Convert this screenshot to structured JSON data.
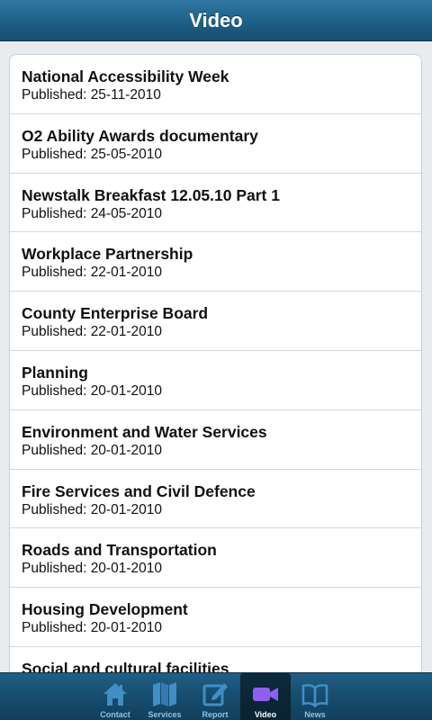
{
  "header": {
    "title": "Video"
  },
  "videos": [
    {
      "title": "National Accessibility Week",
      "published": "Published: 25-11-2010"
    },
    {
      "title": "O2 Ability Awards documentary",
      "published": "Published: 25-05-2010"
    },
    {
      "title": "Newstalk Breakfast 12.05.10 Part 1",
      "published": "Published: 24-05-2010"
    },
    {
      "title": "Workplace Partnership",
      "published": "Published: 22-01-2010"
    },
    {
      "title": "County Enterprise Board",
      "published": "Published: 22-01-2010"
    },
    {
      "title": "Planning",
      "published": "Published: 20-01-2010"
    },
    {
      "title": "Environment and Water Services",
      "published": "Published: 20-01-2010"
    },
    {
      "title": "Fire Services and Civil Defence",
      "published": "Published: 20-01-2010"
    },
    {
      "title": "Roads and Transportation",
      "published": "Published: 20-01-2010"
    },
    {
      "title": "Housing Development",
      "published": "Published: 20-01-2010"
    },
    {
      "title": "Social and cultural facilities",
      "published": ""
    }
  ],
  "tabs": [
    {
      "label": "Contact",
      "icon": "house-icon"
    },
    {
      "label": "Services",
      "icon": "map-icon"
    },
    {
      "label": "Report",
      "icon": "pencil-icon"
    },
    {
      "label": "Video",
      "icon": "video-camera-icon"
    },
    {
      "label": "News",
      "icon": "book-icon"
    }
  ],
  "colors": {
    "header": "#1e5f86",
    "tab_label": "#8fc3e6",
    "active_icon": "#8e5ff2",
    "inactive_icon": "#3f8fc4"
  }
}
